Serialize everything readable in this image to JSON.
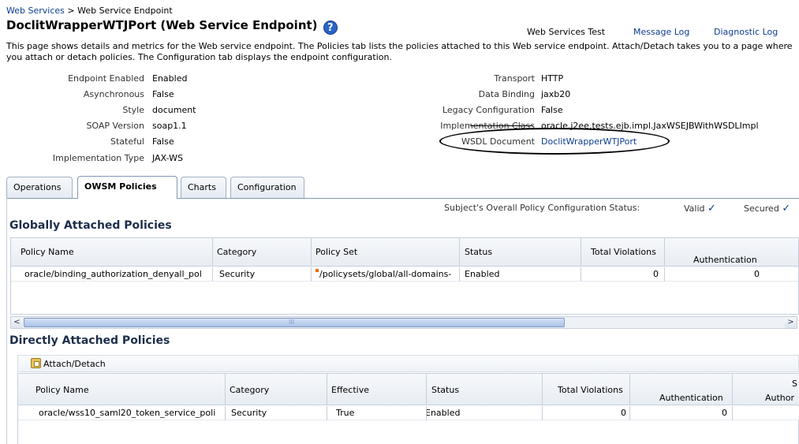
{
  "breadcrumb": {
    "link": "Web Services",
    "separator": " > ",
    "current": "Web Service Endpoint"
  },
  "page": {
    "title": "DoclitWrapperWTJPort (Web Service Endpoint)",
    "help_icon": "?",
    "description": "This page shows details and metrics for the Web service endpoint. The Policies tab lists the policies attached to this Web service endpoint. Attach/Detach takes you to a page where you attach or detach policies. The Configuration tab displays the endpoint configuration."
  },
  "top_links": [
    "Web Services Test",
    "Message Log",
    "Diagnostic Log"
  ],
  "props_left": [
    {
      "label": "Endpoint Enabled",
      "value": "Enabled"
    },
    {
      "label": "Asynchronous",
      "value": "False"
    },
    {
      "label": "Style",
      "value": "document"
    },
    {
      "label": "SOAP Version",
      "value": "soap1.1"
    },
    {
      "label": "Stateful",
      "value": "False"
    },
    {
      "label": "Implementation Type",
      "value": "JAX-WS"
    }
  ],
  "props_right": [
    {
      "label": "Transport",
      "value": "HTTP"
    },
    {
      "label": "Data Binding",
      "value": "jaxb20"
    },
    {
      "label": "Legacy Configuration",
      "value": "False"
    },
    {
      "label": "Implementation Class",
      "value": "oracle.j2ee.tests.ejb.impl.JaxWSEJBWithWSDLImpl"
    },
    {
      "label": "WSDL Document",
      "value": "DoclitWrapperWTJPort"
    }
  ],
  "tabs": [
    "Operations",
    "OWSM Policies",
    "Charts",
    "Configuration"
  ],
  "status": {
    "label": "Subject's Overall Policy Configuration Status:",
    "valid": "Valid",
    "secured": "Secured",
    "check": "✓"
  },
  "global": {
    "heading": "Globally Attached Policies",
    "columns": [
      "Policy Name",
      "Category",
      "Policy Set",
      "Status",
      "Total Violations",
      "Authentication"
    ],
    "rows": [
      [
        "oracle/binding_authorization_denyall_pol",
        "Security",
        "/policysets/global/all-domains-",
        "Enabled",
        "0",
        "0"
      ]
    ]
  },
  "scroll": {
    "left": "<",
    "right": ">",
    "grip": "III"
  },
  "direct": {
    "heading": "Directly Attached Policies",
    "attach_label": "Attach/Detach",
    "columns": [
      "Policy Name",
      "Category",
      "Effective",
      "Status",
      "Total Violations",
      "Authentication",
      "S",
      "Author"
    ],
    "rows": [
      [
        "oracle/wss10_saml20_token_service_poli",
        "Security",
        "True",
        "Enabled",
        "0",
        "0"
      ]
    ]
  }
}
